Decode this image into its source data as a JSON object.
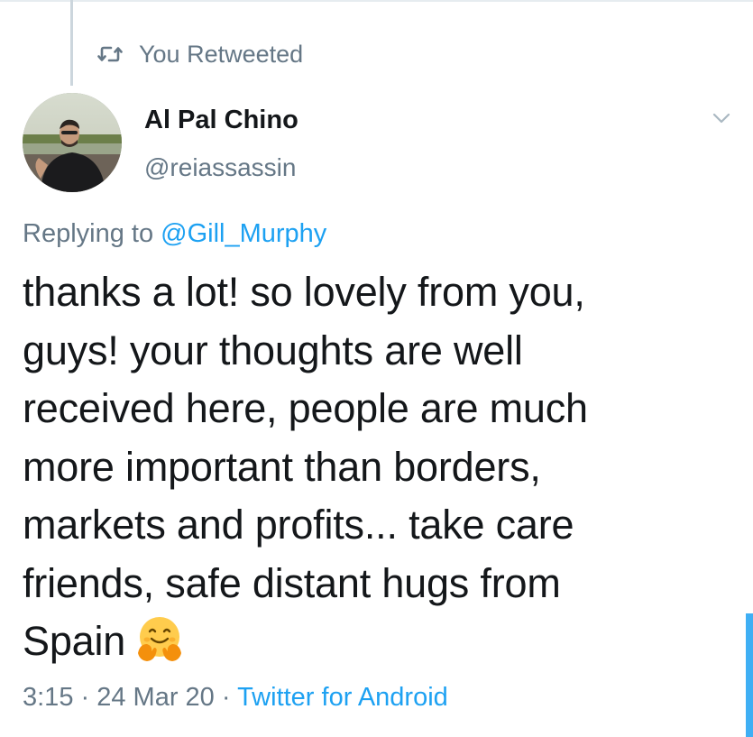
{
  "retweet": {
    "label": "You Retweeted",
    "icon": "retweet-icon"
  },
  "author": {
    "name": "Al Pal Chino",
    "handle": "@reiassassin",
    "avatar": "avatar-photo"
  },
  "reply": {
    "prefix": "Replying to ",
    "mention": "@Gill_Murphy"
  },
  "tweet": {
    "lines": [
      "thanks a lot! so lovely from you,",
      "guys! your thoughts are well",
      "received here, people are much",
      "more important than borders,",
      "markets and profits... take care",
      "friends, safe distant hugs from",
      "Spain"
    ],
    "emoji": "hugging-face-emoji"
  },
  "meta": {
    "time": "3:15",
    "separator1": " · ",
    "date": "24 Mar 20",
    "separator2": " · ",
    "source": "Twitter for Android"
  },
  "colors": {
    "link": "#1da1f2",
    "secondary_text": "#657786",
    "primary_text": "#14171a"
  }
}
